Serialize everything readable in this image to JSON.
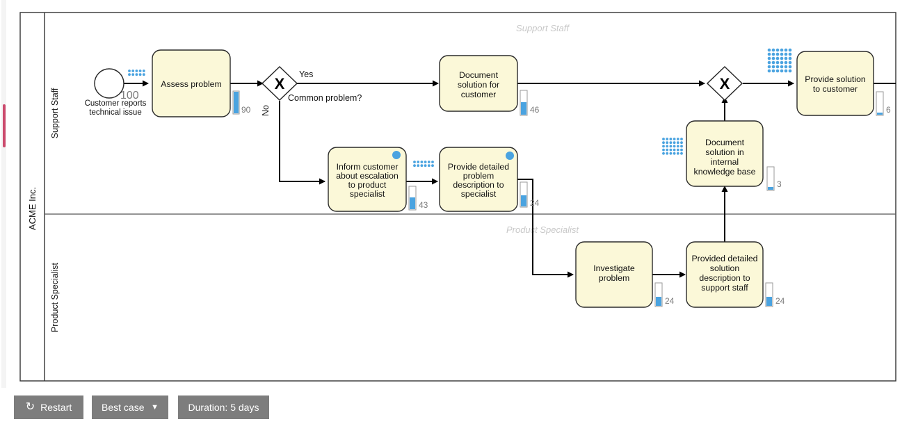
{
  "pool": {
    "label": "ACME Inc."
  },
  "lanes": [
    {
      "label": "Support Staff",
      "watermark": "Support Staff"
    },
    {
      "label": "Product Specialist",
      "watermark": "Product Specialist"
    }
  ],
  "start_event": {
    "label": "Customer reports technical issue",
    "token_count": "100"
  },
  "gateways": [
    {
      "name": "common-problem-gateway",
      "symbol": "X",
      "label": "Common problem?"
    },
    {
      "name": "merge-gateway",
      "symbol": "X",
      "label": ""
    }
  ],
  "flow_labels": {
    "yes": "Yes",
    "no": "No"
  },
  "tasks": [
    {
      "id": "assess-problem",
      "label": "Assess problem",
      "lines": [
        "Assess problem"
      ],
      "count": "90",
      "meter_pct": 100,
      "user_task": false,
      "queue_dots": {
        "cols": 5,
        "rows": 2
      }
    },
    {
      "id": "document-solution-for-customer",
      "label": "Document solution for customer",
      "lines": [
        "Document",
        "solution for",
        "customer"
      ],
      "count": "46",
      "meter_pct": 55,
      "user_task": false,
      "queue_dots": null
    },
    {
      "id": "inform-customer-about-escalation",
      "label": "Inform customer about escalation to product specialist",
      "lines": [
        "Inform customer",
        "about escalation",
        "to product",
        "specialist"
      ],
      "count": "43",
      "meter_pct": 45,
      "user_task": true,
      "queue_dots": null
    },
    {
      "id": "provide-detailed-problem-description",
      "label": "Provide detailed problem description to specialist",
      "lines": [
        "Provide detailed",
        "problem",
        "description to",
        "specialist"
      ],
      "count": "24",
      "meter_pct": 40,
      "user_task": true,
      "queue_dots": {
        "cols": 6,
        "rows": 2
      }
    },
    {
      "id": "investigate-problem",
      "label": "Investigate problem",
      "lines": [
        "Investigate",
        "problem"
      ],
      "count": "24",
      "meter_pct": 22,
      "user_task": false,
      "queue_dots": null
    },
    {
      "id": "provided-detailed-solution-description",
      "label": "Provided detailed solution description to support staff",
      "lines": [
        "Provided detailed",
        "solution",
        "description to",
        "support staff"
      ],
      "count": "24",
      "meter_pct": 22,
      "user_task": false,
      "queue_dots": null
    },
    {
      "id": "document-solution-in-kb",
      "label": "Document solution in internal knowledge base",
      "lines": [
        "Document",
        "solution in",
        "internal",
        "knowledge base"
      ],
      "count": "3",
      "meter_pct": 8,
      "user_task": false,
      "queue_dots": {
        "cols": 6,
        "rows": 5
      }
    },
    {
      "id": "provide-solution-to-customer",
      "label": "Provide solution to customer",
      "lines": [
        "Provide solution",
        "to customer"
      ],
      "count": "6",
      "meter_pct": 7,
      "user_task": false,
      "queue_dots": {
        "cols": 6,
        "rows": 6
      }
    }
  ],
  "toolbar": {
    "restart_label": "Restart",
    "restart_icon": "refresh-icon",
    "case_label": "Best case",
    "case_caret": "chevron-down-icon",
    "duration_label": "Duration: 5 days"
  },
  "colors": {
    "task_fill": "#fbf8d8",
    "accent_blue": "#4aa3e0",
    "toolbar_button": "#7d7d7d",
    "scrollbar_thumb": "#cc4b6e",
    "watermark": "#c8c8c8"
  }
}
